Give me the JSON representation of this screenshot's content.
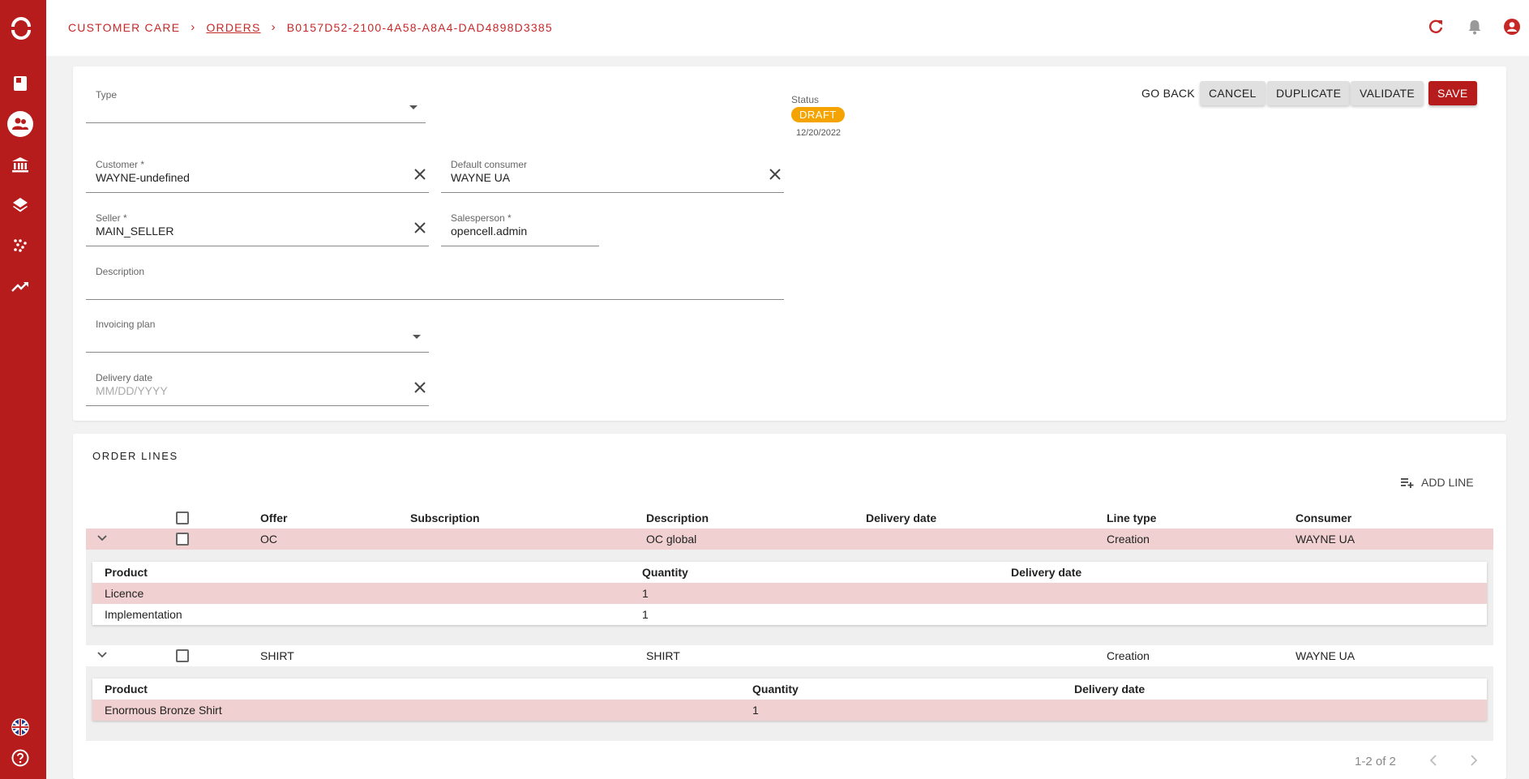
{
  "sidebar": {
    "items": [
      {
        "icon": "app-logo-icon"
      },
      {
        "icon": "book-icon"
      },
      {
        "icon": "people-icon",
        "active": true
      },
      {
        "icon": "bank-icon"
      },
      {
        "icon": "layers-icon"
      },
      {
        "icon": "pattern-icon"
      },
      {
        "icon": "trending-icon"
      }
    ],
    "bottom": [
      {
        "icon": "uk-flag-icon"
      },
      {
        "icon": "help-icon"
      }
    ]
  },
  "header": {
    "breadcrumb": [
      "CUSTOMER CARE",
      "ORDERS",
      "B0157D52-2100-4A58-A8A4-DAD4898D3385"
    ],
    "icons": [
      "refresh-icon",
      "bell-icon",
      "account-icon"
    ]
  },
  "form": {
    "type": {
      "label": "Type",
      "value": ""
    },
    "status": {
      "label": "Status",
      "badge": "DRAFT",
      "date": "12/20/2022",
      "badge_color": "#f5a300"
    },
    "customer": {
      "label": "Customer *",
      "value": "WAYNE-undefined"
    },
    "default_consumer": {
      "label": "Default consumer",
      "value": "WAYNE UA"
    },
    "seller": {
      "label": "Seller *",
      "value": "MAIN_SELLER"
    },
    "salesperson": {
      "label": "Salesperson *",
      "value": "opencell.admin"
    },
    "description": {
      "label": "Description",
      "value": ""
    },
    "invoicing_plan": {
      "label": "Invoicing plan",
      "value": ""
    },
    "delivery_date": {
      "label": "Delivery date",
      "placeholder": "MM/DD/YYYY"
    }
  },
  "actions": {
    "go_back": "GO BACK",
    "cancel": "CANCEL",
    "duplicate": "DUPLICATE",
    "validate": "VALIDATE",
    "save": "SAVE"
  },
  "order_lines": {
    "title": "ORDER LINES",
    "add_line": "ADD LINE",
    "columns": [
      "Offer",
      "Subscription",
      "Description",
      "Delivery date",
      "Line type",
      "Consumer"
    ],
    "rows": [
      {
        "offer": "OC",
        "subscription": "",
        "description": "OC global",
        "delivery_date": "",
        "line_type": "Creation",
        "consumer": "WAYNE UA",
        "sub_columns": [
          "Product",
          "Quantity",
          "Delivery date"
        ],
        "products": [
          {
            "product": "Licence",
            "quantity": "1",
            "delivery_date": ""
          },
          {
            "product": "Implementation",
            "quantity": "1",
            "delivery_date": ""
          }
        ]
      },
      {
        "offer": "SHIRT",
        "subscription": "",
        "description": "SHIRT",
        "delivery_date": "",
        "line_type": "Creation",
        "consumer": "WAYNE UA",
        "sub_columns": [
          "Product",
          "Quantity",
          "Delivery date"
        ],
        "products": [
          {
            "product": "Enormous Bronze Shirt",
            "quantity": "1",
            "delivery_date": ""
          }
        ]
      }
    ],
    "pagination": "1-2 of 2"
  },
  "colors": {
    "brand": "#b71c1c",
    "row_highlight": "#f0d0d0",
    "draft": "#f5a300"
  }
}
